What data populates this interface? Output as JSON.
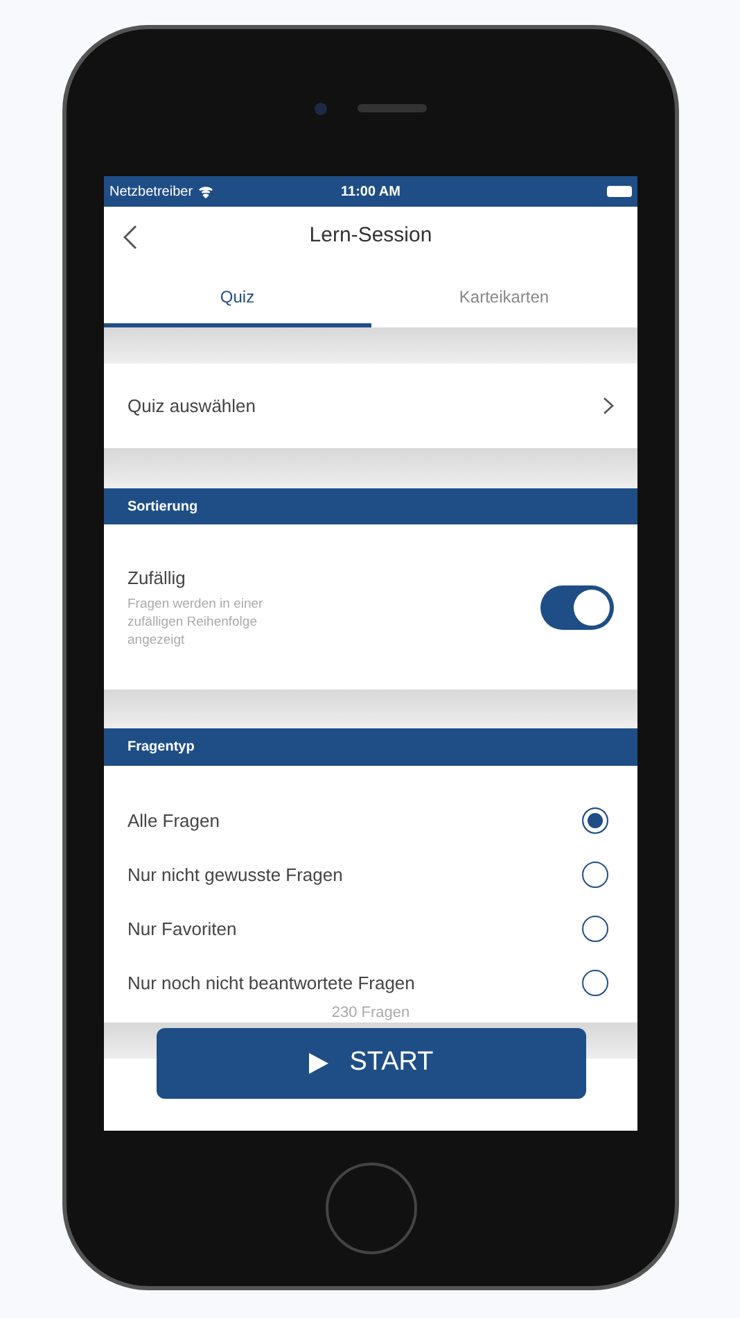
{
  "status_bar": {
    "carrier": "Netzbetreiber",
    "time": "11:00 AM"
  },
  "header": {
    "title": "Lern-Session"
  },
  "tabs": [
    {
      "label": "Quiz",
      "selected": true
    },
    {
      "label": "Karteikarten",
      "selected": false
    }
  ],
  "quiz_select": {
    "label": "Quiz auswählen"
  },
  "sorting": {
    "heading": "Sortierung",
    "option": {
      "title": "Zufällig",
      "description": "Fragen werden in einer zufälligen Reihenfolge angezeigt",
      "on": true
    }
  },
  "question_type": {
    "heading": "Fragentyp",
    "options": [
      {
        "label": "Alle Fragen",
        "selected": true
      },
      {
        "label": "Nur nicht gewusste Fragen",
        "selected": false
      },
      {
        "label": "Nur Favoriten",
        "selected": false
      },
      {
        "label": "Nur noch nicht beantwortete Fragen",
        "selected": false
      }
    ]
  },
  "count": "230 Fragen",
  "start_button": {
    "label": "START"
  }
}
